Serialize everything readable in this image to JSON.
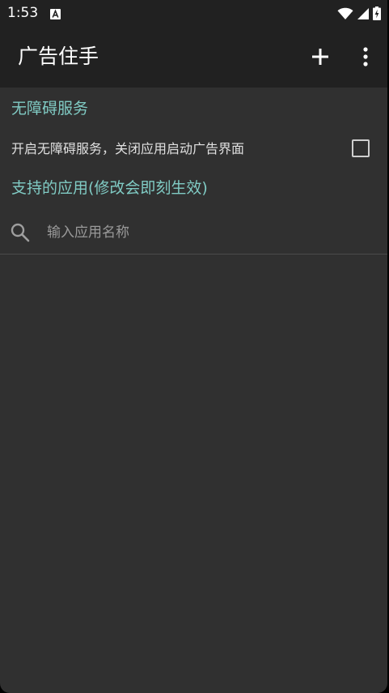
{
  "status_bar": {
    "time": "1:53",
    "notification_icon": "app-notification-icon",
    "wifi_icon": "wifi-icon",
    "signal_icon": "cell-signal-icon",
    "battery_icon": "battery-charging-icon"
  },
  "app_bar": {
    "title": "广告住手",
    "add_icon": "plus-icon",
    "more_icon": "more-vert-icon"
  },
  "accessibility_section": {
    "header": "无障碍服务",
    "toggle_label": "开启无障碍服务，关闭应用启动广告界面",
    "checked": false
  },
  "apps_section": {
    "header": "支持的应用(修改会即刻生效)",
    "search_placeholder": "输入应用名称",
    "search_value": "",
    "items": []
  },
  "colors": {
    "background": "#303030",
    "app_bar": "#212121",
    "accent": "#80cbc4",
    "text_primary": "#ffffff",
    "text_secondary": "#e0e0e0",
    "hint": "#9a9a9a"
  }
}
